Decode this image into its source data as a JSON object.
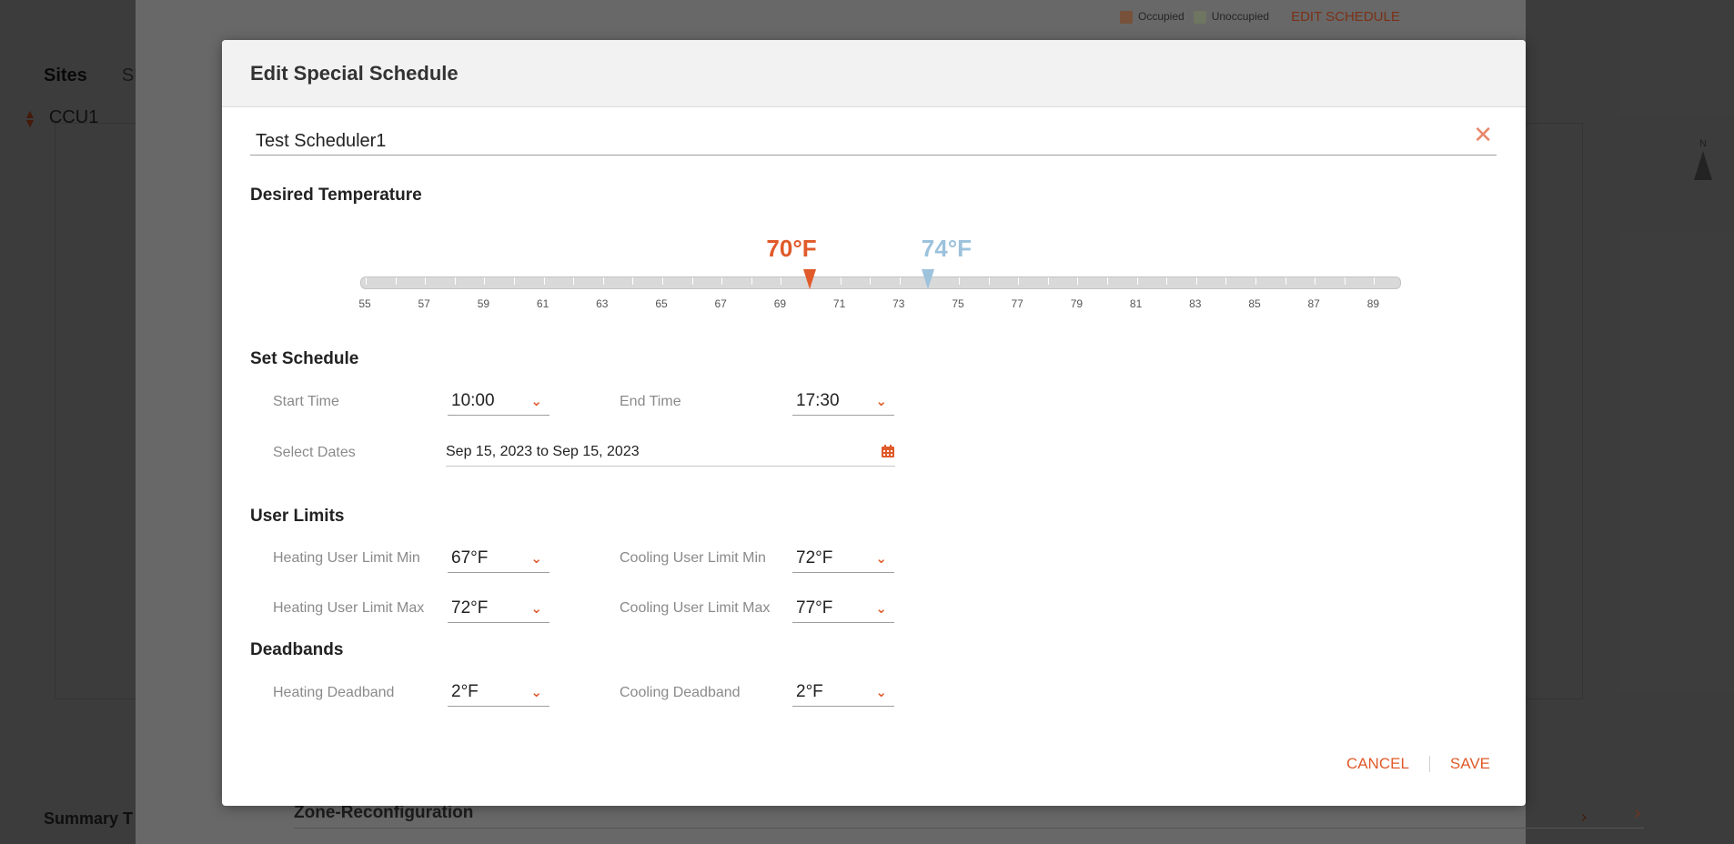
{
  "background": {
    "nav": [
      "Sites",
      "SF"
    ],
    "ccu_label": "CCU1",
    "summary_label": "Summary T",
    "compass_label": "N"
  },
  "legend": {
    "occupied": "Occupied",
    "unoccupied": "Unoccupied",
    "edit": "EDIT SCHEDULE",
    "occupied_color": "#d9946b",
    "unoccupied_color": "#c8d5b0"
  },
  "zone_row": {
    "label": "Zone-Reconfiguration"
  },
  "modal": {
    "title": "Edit Special Schedule",
    "schedule_name": "Test Scheduler1",
    "desired_temperature": {
      "title": "Desired Temperature",
      "heating_label": "70°F",
      "cooling_label": "74°F",
      "heating_value": 70,
      "cooling_value": 74,
      "min": 55,
      "max": 90,
      "ticks": [
        "55",
        "57",
        "59",
        "61",
        "63",
        "65",
        "67",
        "69",
        "71",
        "73",
        "75",
        "77",
        "79",
        "81",
        "83",
        "85",
        "87",
        "89"
      ],
      "heating_color": "#e05a2a",
      "cooling_color": "#9cc2dc"
    },
    "set_schedule": {
      "title": "Set Schedule",
      "start_time_label": "Start Time",
      "start_time": "10:00",
      "end_time_label": "End Time",
      "end_time": "17:30",
      "select_dates_label": "Select Dates",
      "dates": "Sep 15, 2023 to Sep 15, 2023"
    },
    "user_limits": {
      "title": "User Limits",
      "heating_min_label": "Heating User Limit Min",
      "heating_min": "67°F",
      "cooling_min_label": "Cooling User Limit Min",
      "cooling_min": "72°F",
      "heating_max_label": "Heating User Limit Max",
      "heating_max": "72°F",
      "cooling_max_label": "Cooling User Limit Max",
      "cooling_max": "77°F"
    },
    "deadbands": {
      "title": "Deadbands",
      "heating_label": "Heating Deadband",
      "heating": "2°F",
      "cooling_label": "Cooling Deadband",
      "cooling": "2°F"
    },
    "buttons": {
      "cancel": "CANCEL",
      "save": "SAVE"
    }
  }
}
